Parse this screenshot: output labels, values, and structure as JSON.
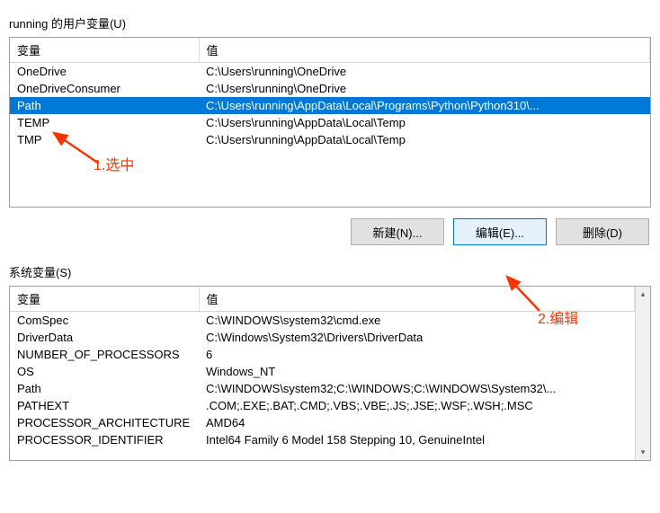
{
  "user_section": {
    "label": "running 的用户变量(U)",
    "headers": {
      "name": "变量",
      "value": "值"
    },
    "rows": [
      {
        "name": "OneDrive",
        "value": "C:\\Users\\running\\OneDrive",
        "selected": false
      },
      {
        "name": "OneDriveConsumer",
        "value": "C:\\Users\\running\\OneDrive",
        "selected": false
      },
      {
        "name": "Path",
        "value": "C:\\Users\\running\\AppData\\Local\\Programs\\Python\\Python310\\...",
        "selected": true
      },
      {
        "name": "TEMP",
        "value": "C:\\Users\\running\\AppData\\Local\\Temp",
        "selected": false
      },
      {
        "name": "TMP",
        "value": "C:\\Users\\running\\AppData\\Local\\Temp",
        "selected": false
      }
    ]
  },
  "system_section": {
    "label": "系统变量(S)",
    "headers": {
      "name": "变量",
      "value": "值"
    },
    "rows": [
      {
        "name": "ComSpec",
        "value": "C:\\WINDOWS\\system32\\cmd.exe"
      },
      {
        "name": "DriverData",
        "value": "C:\\Windows\\System32\\Drivers\\DriverData"
      },
      {
        "name": "NUMBER_OF_PROCESSORS",
        "value": "6"
      },
      {
        "name": "OS",
        "value": "Windows_NT"
      },
      {
        "name": "Path",
        "value": "C:\\WINDOWS\\system32;C:\\WINDOWS;C:\\WINDOWS\\System32\\..."
      },
      {
        "name": "PATHEXT",
        "value": ".COM;.EXE;.BAT;.CMD;.VBS;.VBE;.JS;.JSE;.WSF;.WSH;.MSC"
      },
      {
        "name": "PROCESSOR_ARCHITECTURE",
        "value": "AMD64"
      },
      {
        "name": "PROCESSOR_IDENTIFIER",
        "value": "Intel64 Family 6 Model 158 Stepping 10, GenuineIntel"
      }
    ]
  },
  "buttons": {
    "new": "新建(N)...",
    "edit": "编辑(E)...",
    "delete": "删除(D)"
  },
  "annotations": {
    "a1": "1.选中",
    "a2": "2.编辑"
  },
  "colors": {
    "selection": "#0078d7",
    "annotation": "#ff3300"
  }
}
